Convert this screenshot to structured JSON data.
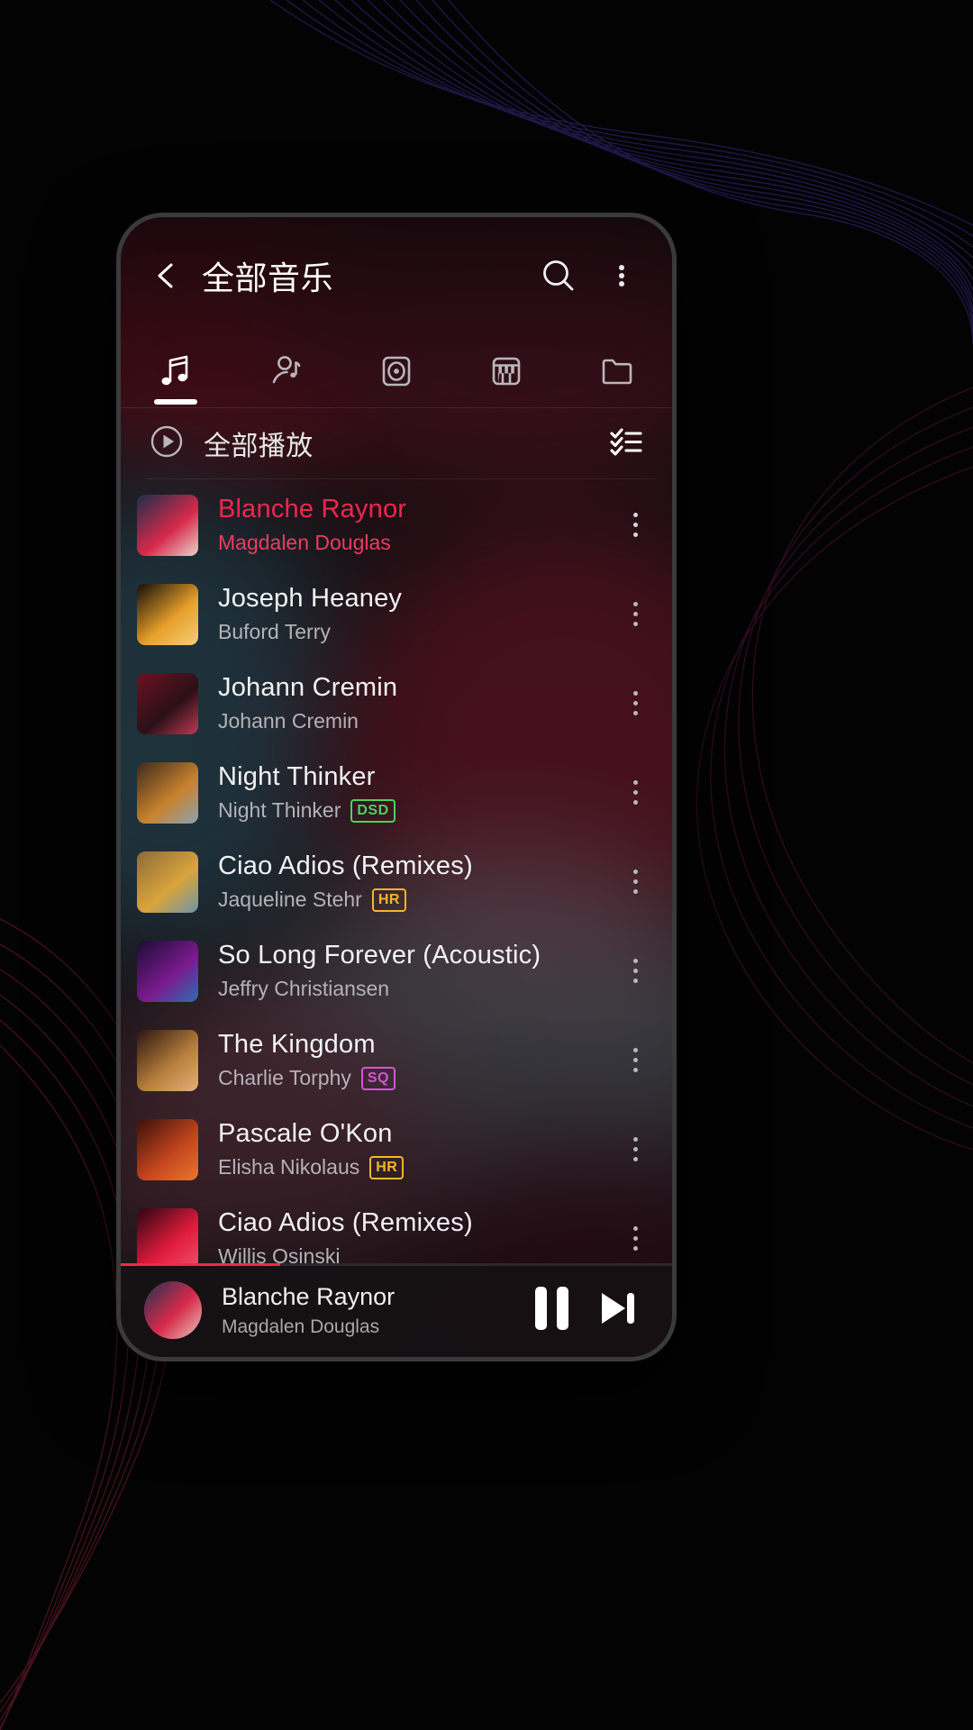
{
  "header": {
    "title": "全部音乐",
    "back_icon": "chevron-left-icon",
    "search_icon": "search-icon",
    "menu_icon": "kebab-menu-icon"
  },
  "tabs": [
    {
      "name": "songs",
      "icon": "music-note-icon",
      "active": true
    },
    {
      "name": "artists",
      "icon": "artist-icon",
      "active": false
    },
    {
      "name": "albums",
      "icon": "album-disc-icon",
      "active": false
    },
    {
      "name": "genres",
      "icon": "piano-keys-icon",
      "active": false
    },
    {
      "name": "folders",
      "icon": "folder-icon",
      "active": false
    }
  ],
  "play_all": {
    "label": "全部播放",
    "play_icon": "play-circle-icon",
    "multiselect_icon": "checklist-icon"
  },
  "songs": [
    {
      "title": "Blanche Raynor",
      "artist": "Magdalen Douglas",
      "badge": "",
      "active": true,
      "art": {
        "c1": "#1a2e4a",
        "c2": "#d8294b",
        "c3": "#e8d4cc"
      }
    },
    {
      "title": "Joseph Heaney",
      "artist": "Buford Terry",
      "badge": "",
      "active": false,
      "art": {
        "c1": "#120d0a",
        "c2": "#e8a02a",
        "c3": "#f2d07a"
      }
    },
    {
      "title": "Johann Cremin",
      "artist": "Johann Cremin",
      "badge": "",
      "active": false,
      "art": {
        "c1": "#6b1222",
        "c2": "#2a1018",
        "c3": "#c03a52"
      }
    },
    {
      "title": "Night Thinker",
      "artist": "Night Thinker",
      "badge": "DSD",
      "active": false,
      "art": {
        "c1": "#3b2a1c",
        "c2": "#c9822e",
        "c3": "#8aa2b4"
      }
    },
    {
      "title": "Ciao Adios (Remixes)",
      "artist": "Jaqueline Stehr",
      "badge": "HR",
      "active": false,
      "art": {
        "c1": "#8e6a3a",
        "c2": "#d9a43c",
        "c3": "#6d95a8"
      }
    },
    {
      "title": "So Long Forever (Acoustic)",
      "artist": "Jeffry Christiansen",
      "badge": "",
      "active": false,
      "art": {
        "c1": "#1b0c33",
        "c2": "#7a1a8e",
        "c3": "#2a6fb0"
      }
    },
    {
      "title": "The Kingdom",
      "artist": "Charlie Torphy",
      "badge": "SQ",
      "active": false,
      "art": {
        "c1": "#2a1410",
        "c2": "#b8803c",
        "c3": "#e2b07c"
      }
    },
    {
      "title": "Pascale O'Kon",
      "artist": "Elisha Nikolaus",
      "badge": "HR",
      "active": false,
      "art": {
        "c1": "#3a0f0a",
        "c2": "#c4461e",
        "c3": "#e8772e"
      }
    },
    {
      "title": "Ciao Adios (Remixes)",
      "artist": "Willis Osinski",
      "badge": "",
      "active": false,
      "art": {
        "c1": "#2a0610",
        "c2": "#e01b3c",
        "c3": "#f05070"
      }
    }
  ],
  "badge_colors": {
    "DSD": "#4ad15e",
    "HR": "#f5b627",
    "SQ": "#d653d6"
  },
  "now_playing": {
    "title": "Blanche Raynor",
    "artist": "Magdalen Douglas",
    "pause_icon": "pause-icon",
    "next_icon": "skip-next-icon",
    "progress_percent": 29
  },
  "theme": {
    "accent": "#f2264f",
    "background": "#000000"
  }
}
